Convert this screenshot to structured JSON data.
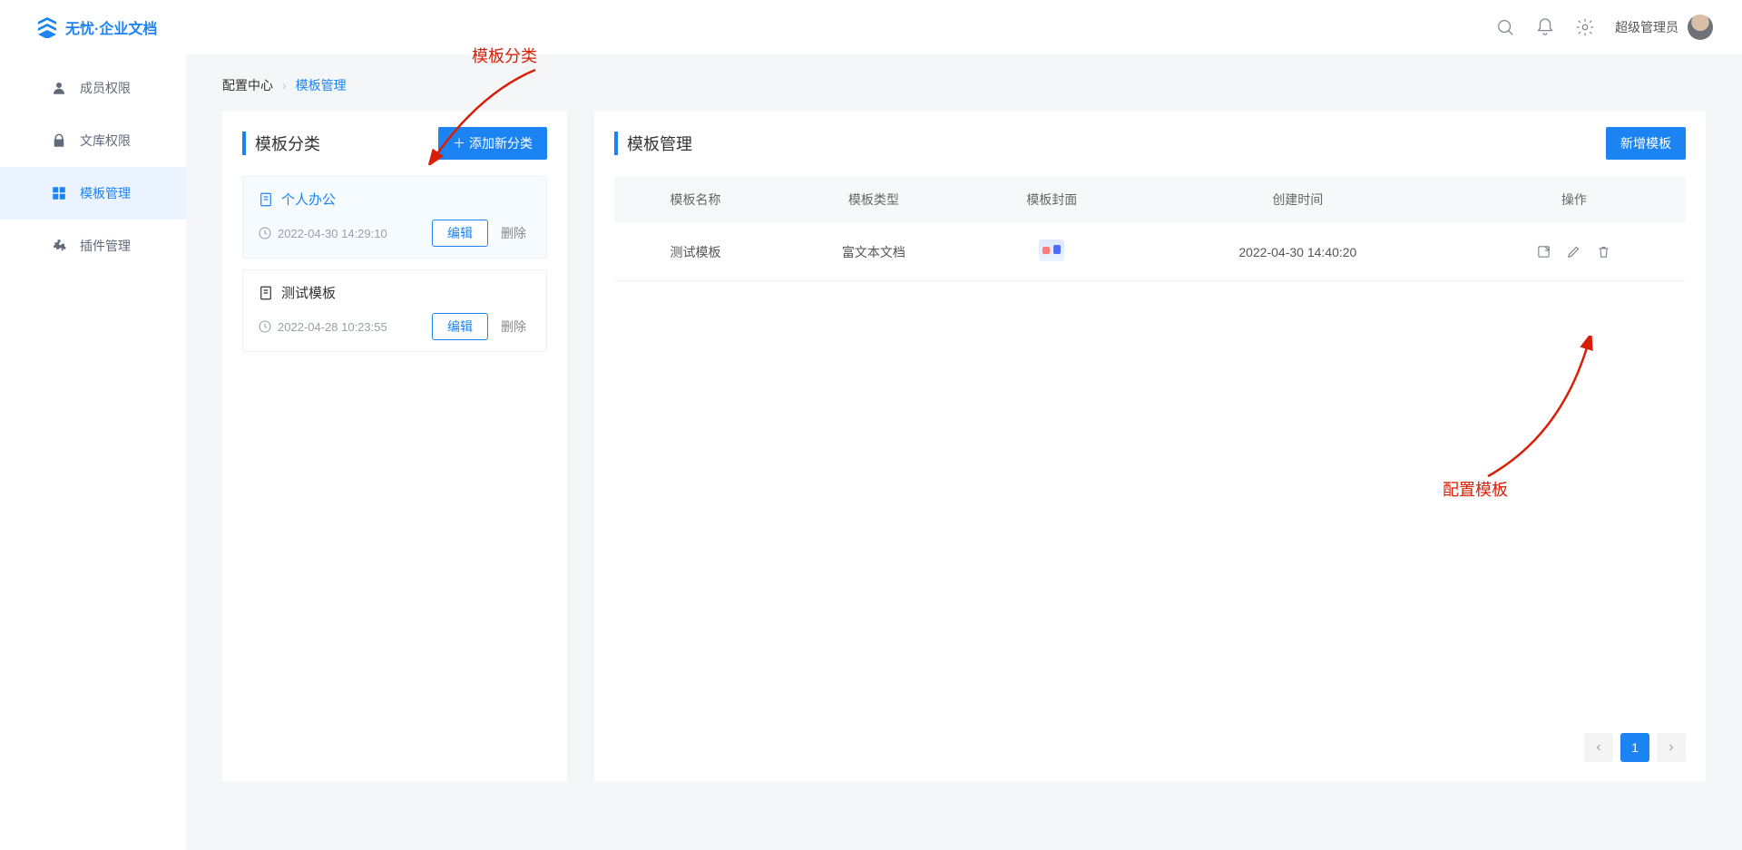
{
  "brand": "无忧·企业文档",
  "header": {
    "user_label": "超级管理员"
  },
  "sidebar": {
    "items": [
      {
        "label": "成员权限"
      },
      {
        "label": "文库权限"
      },
      {
        "label": "模板管理"
      },
      {
        "label": "插件管理"
      }
    ]
  },
  "crumbs": {
    "root": "配置中心",
    "current": "模板管理"
  },
  "category_panel": {
    "title": "模板分类",
    "add_label": "添加新分类",
    "edit_label": "编辑",
    "delete_label": "删除",
    "items": [
      {
        "name": "个人办公",
        "time": "2022-04-30 14:29:10",
        "active": true
      },
      {
        "name": "测试模板",
        "time": "2022-04-28 10:23:55",
        "active": false
      }
    ]
  },
  "template_panel": {
    "title": "模板管理",
    "add_label": "新增模板",
    "columns": [
      "模板名称",
      "模板类型",
      "模板封面",
      "创建时间",
      "操作"
    ],
    "rows": [
      {
        "name": "测试模板",
        "type": "富文本文档",
        "time": "2022-04-30 14:40:20"
      }
    ],
    "page": "1"
  },
  "annotations": {
    "category_hint": "模板分类",
    "config_hint": "配置模板"
  }
}
